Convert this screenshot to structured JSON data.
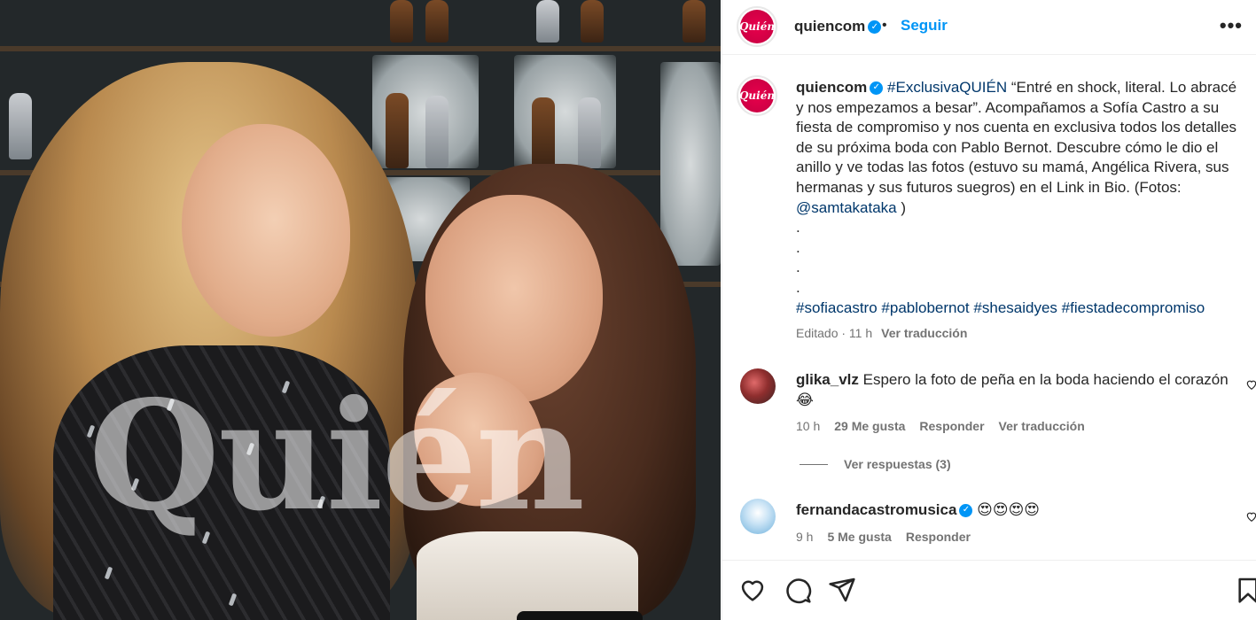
{
  "photo": {
    "watermark": "Quién"
  },
  "header": {
    "avatar_text": "Quién",
    "username": "quiencom",
    "separator": "•",
    "follow_label": "Seguir",
    "more_label": "•••"
  },
  "caption": {
    "avatar_text": "Quién",
    "username": "quiencom",
    "hashtag": "#ExclusivaQUIÉN",
    "text_part1": " “Entré en shock, literal. Lo abracé y nos empezamos a besar”. Acompañamos a Sofía Castro a su fiesta de compromiso y nos cuenta en exclusiva todos los detalles de su próxima boda con Pablo Bernot. Descubre cómo le dio el anillo y ve todas las fotos (estuvo su mamá, Angélica Rivera, sus hermanas y sus futuros suegros) en el Link in Bio. (Fotos: ",
    "mention": "@samtakataka",
    "text_part2": " )",
    "dots": [
      ".",
      ".",
      ".",
      "."
    ],
    "tags": [
      "#sofiacastro",
      "#pablobernot",
      "#shesaidyes",
      "#fiestadecompromiso"
    ],
    "edited": "Editado · 11 h",
    "translate": "Ver traducción"
  },
  "comments": [
    {
      "username": "glika_vlz",
      "text": "Espero la foto de peña en la boda haciendo el corazón 😂",
      "time": "10 h",
      "likes": "29 Me gusta",
      "reply": "Responder",
      "translate": "Ver traducción"
    },
    {
      "username": "fernandacastromusica",
      "text": "😍😍😍😍",
      "time": "9 h",
      "likes": "5 Me gusta",
      "reply": "Responder"
    }
  ],
  "replies": {
    "label": "Ver respuestas (3)"
  },
  "colors": {
    "accent_blue": "#0095f6",
    "link_dark_blue": "#00376b",
    "brand_red": "#e8004c",
    "muted": "#737373"
  }
}
